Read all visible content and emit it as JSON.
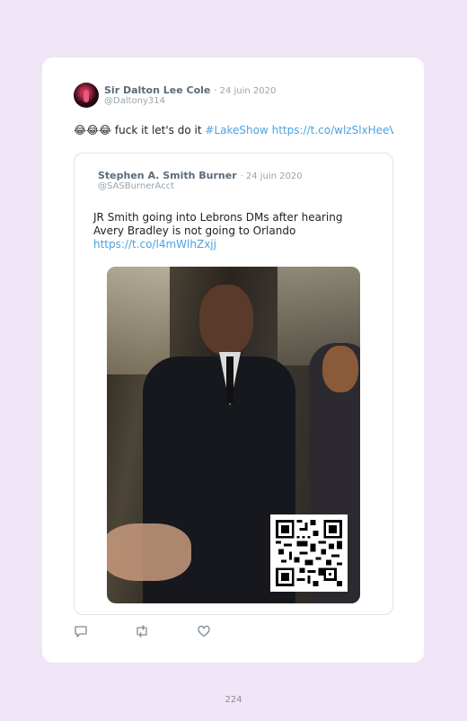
{
  "tweet": {
    "author_name": "Sir Dalton Lee Cole",
    "date": "· 24 juin 2020",
    "handle": "@Daltony314",
    "emoji": "😂😂😂",
    "text": "fuck it let's do it",
    "hashtag": "#LakeShow",
    "link": "https://t.co/wlzSlxHeeVc"
  },
  "quoted": {
    "author_name": "Stephen A. Smith Burner",
    "date": "· 24 juin 2020",
    "handle": "@SASBurnerAcct",
    "text_line1": "JR Smith going into Lebrons DMs after hearing",
    "text_line2": "Avery Bradley is not going to Orlando",
    "link": "https://t.co/l4mWlhZxjj",
    "media_icon": "video-thumbnail-with-qr-code"
  },
  "actions": {
    "reply_icon": "reply-icon",
    "retweet_icon": "retweet-icon",
    "like_icon": "heart-icon"
  },
  "page": {
    "number": "224"
  },
  "colors": {
    "link": "#4aa3df",
    "background": "#f0e6f7"
  }
}
